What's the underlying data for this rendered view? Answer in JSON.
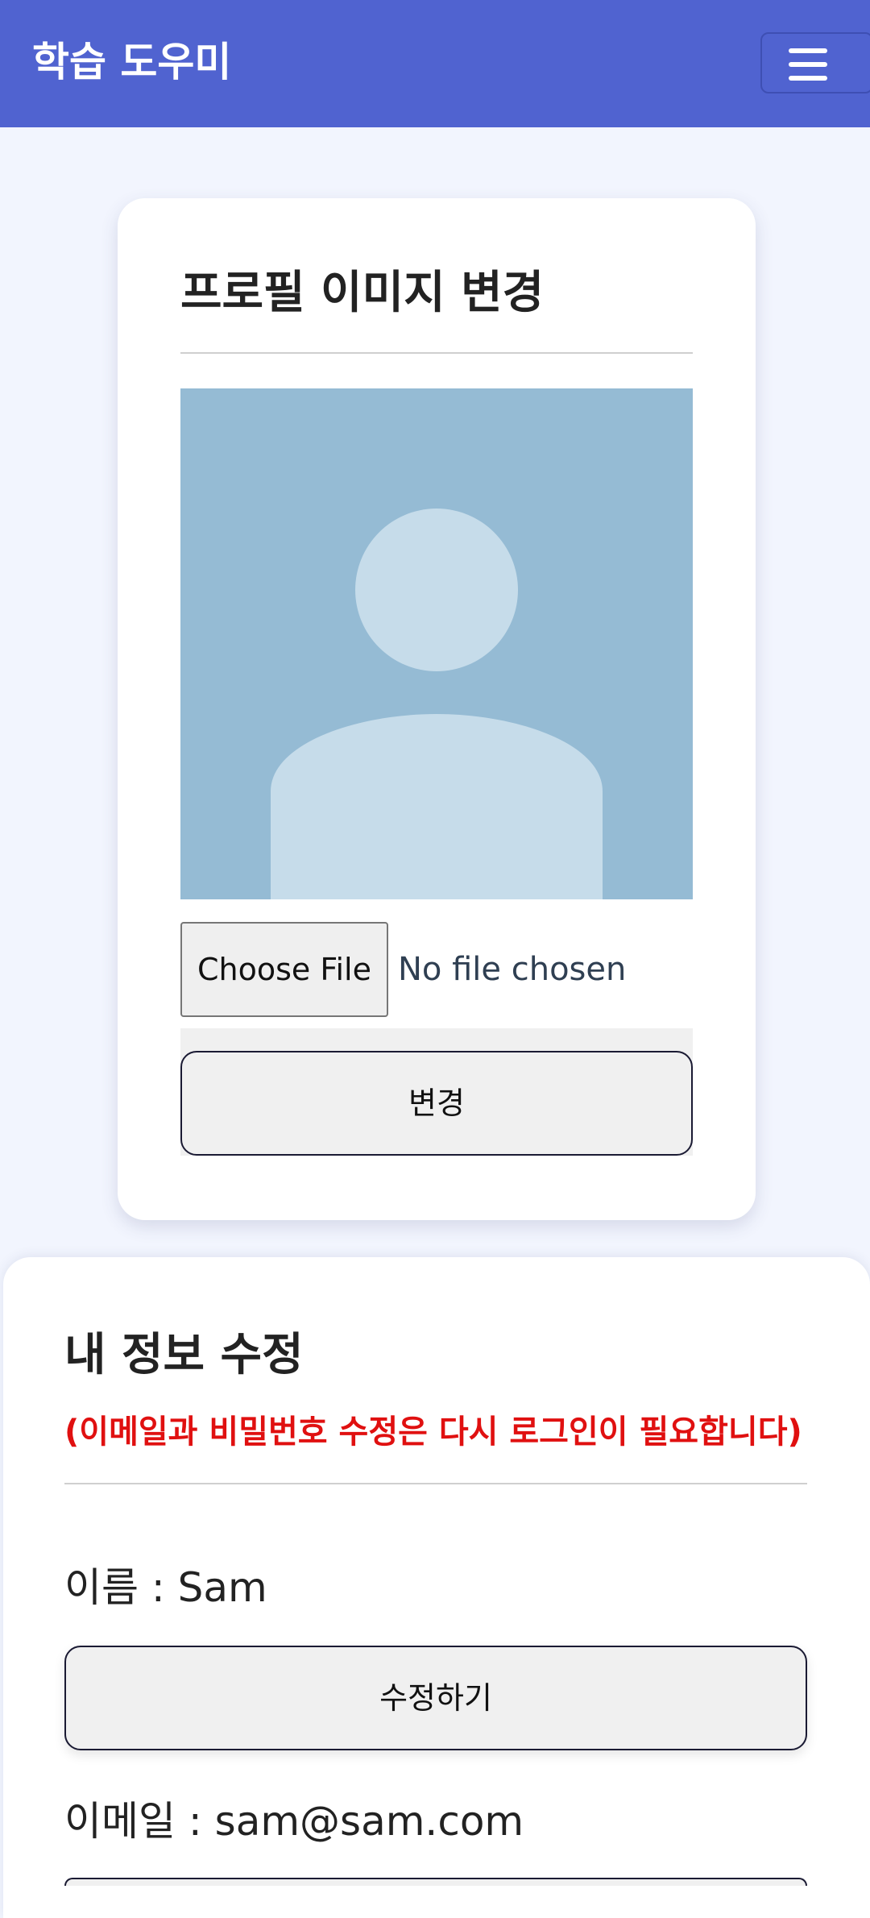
{
  "header": {
    "title": "학습 도우미",
    "menu_icon": "hamburger-menu-icon",
    "background_color": "#5063d0"
  },
  "profile_image_card": {
    "title": "프로필 이미지 변경",
    "avatar_icon": "default-user-avatar-icon",
    "file_input": {
      "button_label": "Choose File",
      "status": "No file chosen"
    },
    "submit_label": "변경"
  },
  "my_info_card": {
    "title": "내 정보 수정",
    "notice": "(이메일과 비밀번호 수정은 다시 로그인이 필요합니다)",
    "notice_color": "#e01010",
    "name": {
      "label": "이름",
      "value": "Sam",
      "edit_label": "수정하기"
    },
    "email": {
      "label": "이메일",
      "value": "sam@sam.com"
    }
  }
}
